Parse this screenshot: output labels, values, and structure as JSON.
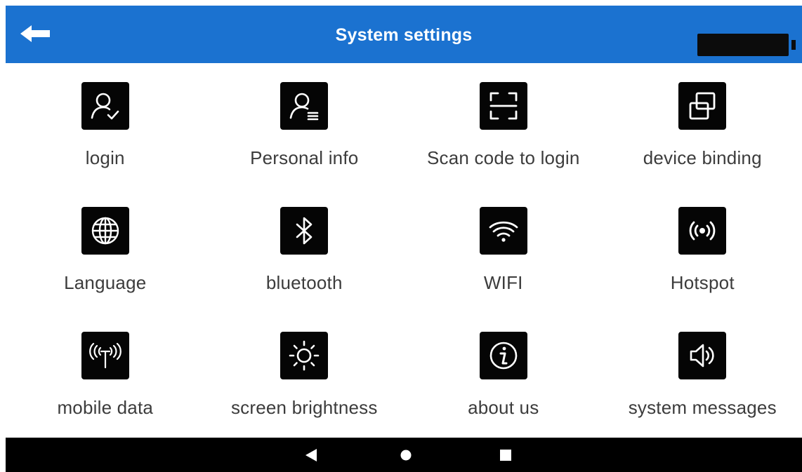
{
  "header": {
    "title": "System settings",
    "back_icon": "arrow-left-icon",
    "color": "#1b72d0"
  },
  "tiles": [
    {
      "label": "login",
      "icon": "user-check-icon"
    },
    {
      "label": "Personal info",
      "icon": "user-list-icon"
    },
    {
      "label": "Scan code to login",
      "icon": "scan-frame-icon"
    },
    {
      "label": "device binding",
      "icon": "linked-squares-icon"
    },
    {
      "label": "Language",
      "icon": "globe-icon"
    },
    {
      "label": "bluetooth",
      "icon": "bluetooth-icon"
    },
    {
      "label": "WIFI",
      "icon": "wifi-icon"
    },
    {
      "label": "Hotspot",
      "icon": "hotspot-icon"
    },
    {
      "label": "mobile data",
      "icon": "antenna-icon"
    },
    {
      "label": "screen brightness",
      "icon": "sun-icon"
    },
    {
      "label": "about us",
      "icon": "info-icon"
    },
    {
      "label": "system messages",
      "icon": "speaker-icon"
    }
  ],
  "navbar": {
    "buttons": [
      {
        "name": "back",
        "icon": "triangle-back-icon"
      },
      {
        "name": "home",
        "icon": "circle-home-icon"
      },
      {
        "name": "recents",
        "icon": "square-recents-icon"
      }
    ]
  }
}
